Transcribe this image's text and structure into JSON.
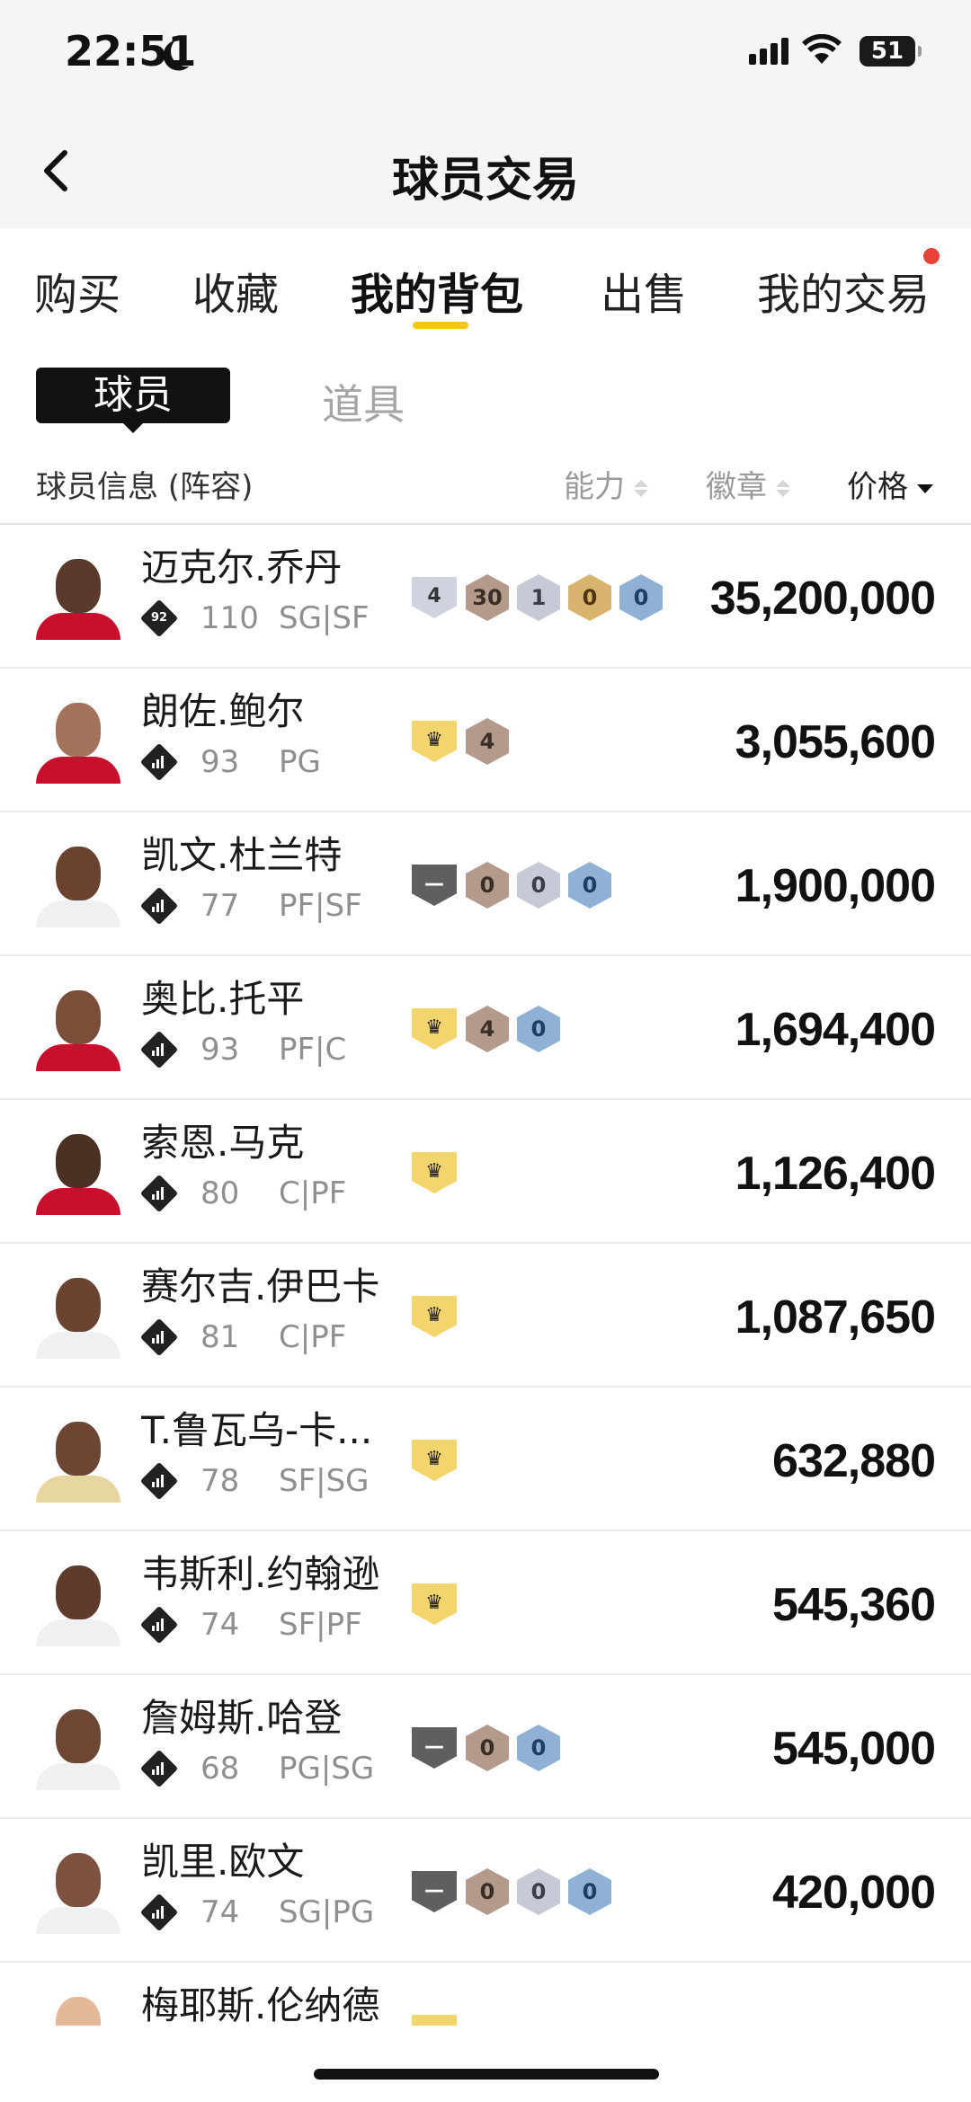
{
  "status_bar": {
    "time": "22:51",
    "battery": "51",
    "moon_icon": "moon-icon",
    "signal_icon": "signal-icon",
    "wifi_icon": "wifi-icon"
  },
  "nav": {
    "title": "球员交易",
    "back_icon": "chevron-left-icon"
  },
  "tabs": [
    {
      "label": "购买"
    },
    {
      "label": "收藏"
    },
    {
      "label": "我的背包",
      "active": true
    },
    {
      "label": "出售"
    },
    {
      "label": "我的交易",
      "notification_dot": true
    }
  ],
  "segments": {
    "active": "球员",
    "other": "道具"
  },
  "columns": {
    "info": "球员信息 (阵容)",
    "ability": "能力",
    "badges": "徽章",
    "price": "价格"
  },
  "players": [
    {
      "name": "迈克尔.乔丹",
      "rating": "110",
      "position": "SG|SF",
      "tier": "92",
      "badges": [
        {
          "kind": "shield",
          "style": "num",
          "text": "4"
        },
        {
          "kind": "hex",
          "style": "bronze",
          "text": "30"
        },
        {
          "kind": "hex",
          "style": "silver",
          "text": "1"
        },
        {
          "kind": "hex",
          "style": "gold",
          "text": "0"
        },
        {
          "kind": "hex",
          "style": "blue",
          "text": "0"
        }
      ],
      "price": "35,200,000",
      "skin": "#5a3a2a",
      "jersey": "#c8102e"
    },
    {
      "name": "朗佐.鲍尔",
      "rating": "93",
      "position": "PG",
      "tier": "",
      "badges": [
        {
          "kind": "shield",
          "style": "crown",
          "text": "♛"
        },
        {
          "kind": "hex",
          "style": "bronze",
          "text": "4"
        }
      ],
      "price": "3,055,600",
      "skin": "#a2735a",
      "jersey": "#c8102e"
    },
    {
      "name": "凯文.杜兰特",
      "rating": "77",
      "position": "PF|SF",
      "tier": "",
      "badges": [
        {
          "kind": "shield",
          "style": "dash",
          "text": "—"
        },
        {
          "kind": "hex",
          "style": "bronze",
          "text": "0"
        },
        {
          "kind": "hex",
          "style": "silver",
          "text": "0"
        },
        {
          "kind": "hex",
          "style": "blue",
          "text": "0"
        }
      ],
      "price": "1,900,000",
      "skin": "#6b4130",
      "jersey": "#f0f0f0"
    },
    {
      "name": "奥比.托平",
      "rating": "93",
      "position": "PF|C",
      "tier": "",
      "badges": [
        {
          "kind": "shield",
          "style": "crown",
          "text": "♛"
        },
        {
          "kind": "hex",
          "style": "bronze",
          "text": "4"
        },
        {
          "kind": "hex",
          "style": "blue",
          "text": "0"
        }
      ],
      "price": "1,694,400",
      "skin": "#7a4e39",
      "jersey": "#c8102e"
    },
    {
      "name": "索恩.马克",
      "rating": "80",
      "position": "C|PF",
      "tier": "",
      "badges": [
        {
          "kind": "shield",
          "style": "crown",
          "text": "♛"
        }
      ],
      "price": "1,126,400",
      "skin": "#4b3024",
      "jersey": "#c8102e"
    },
    {
      "name": "赛尔吉.伊巴卡",
      "rating": "81",
      "position": "C|PF",
      "tier": "",
      "badges": [
        {
          "kind": "shield",
          "style": "crown",
          "text": "♛"
        }
      ],
      "price": "1,087,650",
      "skin": "#6a4331",
      "jersey": "#f0f0f0"
    },
    {
      "name": "T.鲁瓦乌-卡...",
      "rating": "78",
      "position": "SF|SG",
      "tier": "",
      "badges": [
        {
          "kind": "shield",
          "style": "crown",
          "text": "♛"
        }
      ],
      "price": "632,880",
      "skin": "#6c4533",
      "jersey": "#e8d6a0"
    },
    {
      "name": "韦斯利.约翰逊",
      "rating": "74",
      "position": "SF|PF",
      "tier": "",
      "badges": [
        {
          "kind": "shield",
          "style": "crown",
          "text": "♛"
        }
      ],
      "price": "545,360",
      "skin": "#5e3b2b",
      "jersey": "#f0f0f0"
    },
    {
      "name": "詹姆斯.哈登",
      "rating": "68",
      "position": "PG|SG",
      "tier": "",
      "badges": [
        {
          "kind": "shield",
          "style": "dash",
          "text": "—"
        },
        {
          "kind": "hex",
          "style": "bronze",
          "text": "0"
        },
        {
          "kind": "hex",
          "style": "blue",
          "text": "0"
        }
      ],
      "price": "545,000",
      "skin": "#6e4634",
      "jersey": "#f0f0f0"
    },
    {
      "name": "凯里.欧文",
      "rating": "74",
      "position": "SG|PG",
      "tier": "",
      "badges": [
        {
          "kind": "shield",
          "style": "dash",
          "text": "—"
        },
        {
          "kind": "hex",
          "style": "bronze",
          "text": "0"
        },
        {
          "kind": "hex",
          "style": "silver",
          "text": "0"
        },
        {
          "kind": "hex",
          "style": "blue",
          "text": "0"
        }
      ],
      "price": "420,000",
      "skin": "#7d5240",
      "jersey": "#f0f0f0"
    },
    {
      "name": "梅耶斯.伦纳德",
      "rating": "",
      "position": "",
      "tier": "",
      "badges": [
        {
          "kind": "shield",
          "style": "crown",
          "text": ""
        }
      ],
      "price": "",
      "skin": "#e3b99a",
      "jersey": "#c8102e"
    }
  ],
  "colors": {
    "accent": "#f5c518",
    "dot": "#e8413a"
  }
}
